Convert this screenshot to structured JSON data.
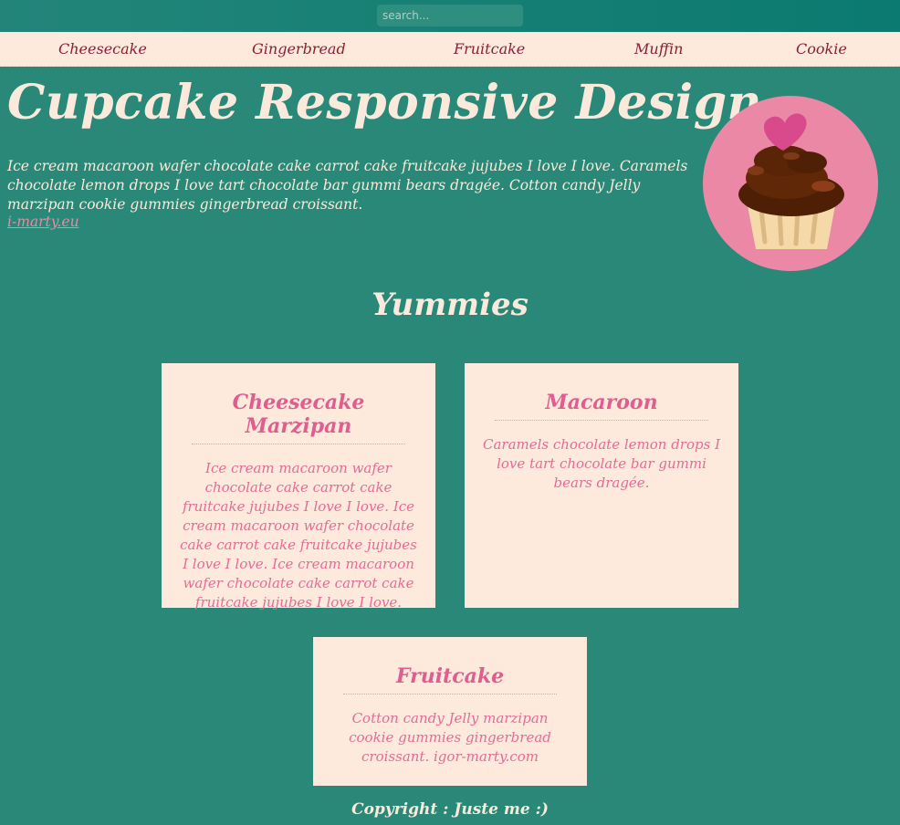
{
  "search": {
    "placeholder": "search..."
  },
  "nav": {
    "items": [
      {
        "label": "Cheesecake"
      },
      {
        "label": "Gingerbread"
      },
      {
        "label": "Fruitcake"
      },
      {
        "label": "Muffin"
      },
      {
        "label": "Cookie"
      }
    ]
  },
  "hero": {
    "title": "Cupcake Responsive Design",
    "intro": "Ice cream macaroon wafer chocolate cake carrot cake fruitcake jujubes I love I love. Caramels chocolate lemon drops I love tart chocolate bar gummi bears dragée. Cotton candy Jelly marzipan cookie gummies gingerbread croissant.",
    "link": "i-marty.eu"
  },
  "section": {
    "title": "Yummies"
  },
  "cards": [
    {
      "title": "Cheesecake Marzipan",
      "text": "Ice cream macaroon wafer chocolate cake carrot cake fruitcake jujubes I love I love. Ice cream macaroon wafer chocolate cake carrot cake fruitcake jujubes I love I love. Ice cream macaroon wafer chocolate cake carrot cake fruitcake jujubes I love I love."
    },
    {
      "title": "Macaroon",
      "text": "Caramels chocolate lemon drops I love tart chocolate bar gummi bears dragée."
    },
    {
      "title": "Fruitcake",
      "text": "Cotton candy Jelly marzipan cookie gummies gingerbread croissant. igor-marty.com"
    }
  ],
  "footer": {
    "text": "Copyright : Juste me :)"
  },
  "colors": {
    "background": "#298877",
    "topbar": "#0b7a70",
    "cream": "#fdeadc",
    "nav_text": "#8a1f39",
    "pink": "#e05d8f",
    "logo_circle": "#ea88a6"
  },
  "icons": {
    "logo": "cupcake-icon"
  }
}
